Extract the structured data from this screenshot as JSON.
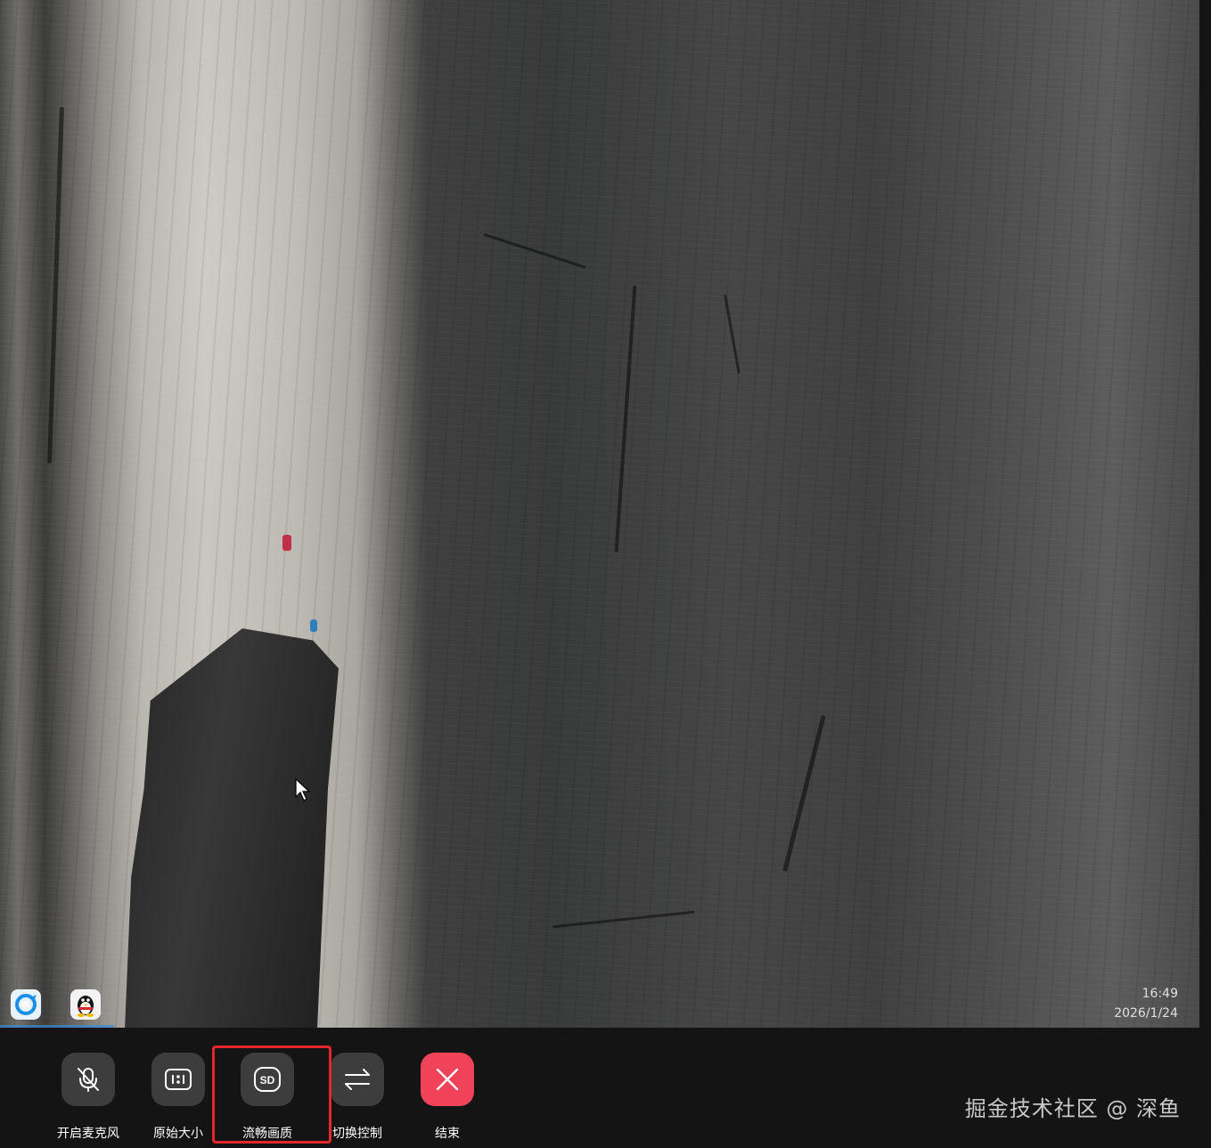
{
  "remote_desktop": {
    "taskbar": {
      "icons": [
        {
          "name": "browser-app-icon"
        },
        {
          "name": "qq-penguin-icon"
        }
      ]
    },
    "clock": {
      "time": "16:49",
      "date": "2026/1/24"
    }
  },
  "control_bar": {
    "buttons": [
      {
        "id": "mic",
        "label": "开启麦克风",
        "icon": "mic-off-icon"
      },
      {
        "id": "original",
        "label": "原始大小",
        "icon": "ratio-1-1-icon"
      },
      {
        "id": "quality",
        "label": "流畅画质",
        "icon": "sd-quality-icon",
        "highlighted": true
      },
      {
        "id": "switch",
        "label": "切换控制",
        "icon": "swap-arrows-icon"
      },
      {
        "id": "end",
        "label": "结束",
        "icon": "close-icon"
      }
    ]
  },
  "watermark": "掘金技术社区 @ 深鱼",
  "colors": {
    "bar_background": "#141414",
    "button_background": "#3d3d3d",
    "end_button": "#f0435a",
    "highlight": "#e5262d"
  }
}
